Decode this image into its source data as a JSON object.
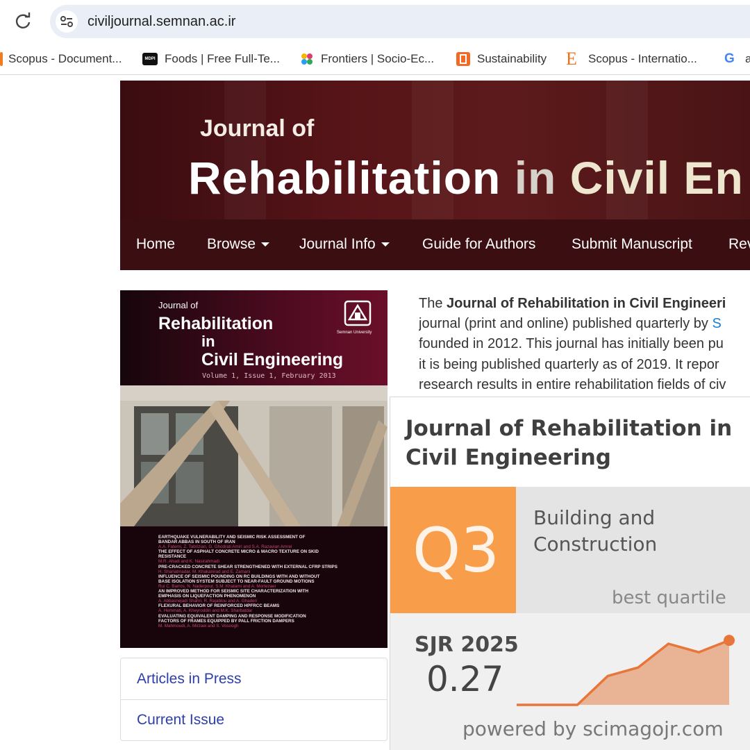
{
  "browser": {
    "url": "civiljournal.semnan.ac.ir",
    "bookmarks": [
      {
        "label": "Scopus - Document...",
        "icon": "scopus-bar-icon",
        "color": "#f07c22"
      },
      {
        "label": "Foods | Free Full-Te...",
        "icon": "mdpi-icon",
        "color": "#111111"
      },
      {
        "label": "Frontiers | Socio-Ec...",
        "icon": "frontiers-icon",
        "color": "#e23b6b"
      },
      {
        "label": "Sustainability",
        "icon": "sustainability-icon",
        "color": "#f26a24"
      },
      {
        "label": "Scopus - Internatio...",
        "icon": "elsevier-icon",
        "color": "#e9711c"
      },
      {
        "label": "a",
        "icon": "google-icon",
        "color": "#4285f4"
      }
    ]
  },
  "banner": {
    "line1": "Journal of",
    "line2_a": "Rehabilitation",
    "line2_b": "in",
    "line2_c": "Civil En"
  },
  "nav": {
    "items": [
      {
        "label": "Home"
      },
      {
        "label": "Browse",
        "dropdown": true
      },
      {
        "label": "Journal Info",
        "dropdown": true
      },
      {
        "label": "Guide for Authors"
      },
      {
        "label": "Submit Manuscript"
      },
      {
        "label": "Rev"
      }
    ]
  },
  "cover": {
    "journal_of": "Journal of",
    "title1": "Rehabilitation",
    "title2": "in",
    "title3": "Civil Engineering",
    "volume": "Volume 1, Issue 1, February 2013",
    "logo_text": "Semnan University",
    "articles": [
      {
        "t": "EARTHQUAKE VULNERABILITY AND SEISMIC RISK ASSESSMENT OF",
        "a": false
      },
      {
        "t": "BANDAR ABBAS IN SOUTH OF IRAN",
        "a": false
      },
      {
        "t": "A.A. Fatemi, Z. Tabrizian, G. Ghodrati Amiri and S.A. Razavian Amrei",
        "a": true
      },
      {
        "t": "THE EFFECT OF ASPHALT CONCRETE MICRO & MACRO TEXTURE ON SKID",
        "a": false
      },
      {
        "t": "RESISTANCE",
        "a": false
      },
      {
        "t": "M.R. Ahadi and K. Nasirahmadi",
        "a": true
      },
      {
        "t": "PRE-CRACKED CONCRETE SHEAR STRENGTHENED WITH EXTERNAL CFRP STRIPS",
        "a": false
      },
      {
        "t": "H. Shariatmadar, M. Khakanirad and E. Zamani",
        "a": true
      },
      {
        "t": "INFLUENCE OF SEISMIC POUNDING ON RC BUILDINGS WITH AND WITHOUT",
        "a": false
      },
      {
        "t": "BASE ISOLATION SYSTEM SUBJECT TO NEAR-FAULT GROUND MOTIONS",
        "a": false
      },
      {
        "t": "Rui C. Barros, N. Naderpour, S.M. Khatami and A. Mortezaei",
        "a": true
      },
      {
        "t": "AN IMPROVED METHOD FOR SEISMIC SITE CHARACTERIZATION WITH",
        "a": false
      },
      {
        "t": "EMPHASIS ON LIQUEFACTION PHENOMENON",
        "a": false
      },
      {
        "t": "A. Abbasnejadi Shahri, R. Rajablou and A. Ghaderi",
        "a": true
      },
      {
        "t": "FLEXURAL BEHAVIOR OF REINFORCED HPFRCC BEAMS",
        "a": false
      },
      {
        "t": "A. Hemmati, A. Kheyroddin and M.K. Sharbatdar",
        "a": true
      },
      {
        "t": "EVALUATING EQUIVALENT DAMPING AND RESPONSE MODIFICATION",
        "a": false
      },
      {
        "t": "FACTORS OF FRAMES EQUIPPED BY PALL FRICTION DAMPERS",
        "a": false
      },
      {
        "t": "M. Mahmoudi, A. Mirzaei and S. Vosoogh",
        "a": true
      }
    ]
  },
  "sidebar_links": [
    {
      "label": "Articles in Press"
    },
    {
      "label": "Current Issue"
    }
  ],
  "intro": {
    "l1_pre": "The ",
    "l1_bold": "Journal of Rehabilitation in Civil Engineeri",
    "l2_pre": "journal (print and online) published quarterly by ",
    "l2_link": "S",
    "l3": "founded in 2012. This journal has initially been pu",
    "l4": "it is being published quarterly as of 2019. It repor",
    "l5": "research results in entire rehabilitation fields of civ"
  },
  "sjr_widget": {
    "title_l1": "Journal of Rehabilitation in",
    "title_l2": "Civil Engineering",
    "quartile": "Q3",
    "category_l1": "Building and",
    "category_l2": "Construction",
    "best_quartile": "best quartile",
    "sjr_label": "SJR 2025",
    "sjr_value": "0.27",
    "powered_by": "powered by scimagojr.com",
    "accent_color": "#f89e4a"
  },
  "chart_data": {
    "type": "area",
    "series": [
      {
        "values": [
          0.0,
          0.0,
          0.0,
          0.17,
          0.22,
          0.36,
          0.31,
          0.38
        ]
      }
    ],
    "ylim": [
      0,
      0.45
    ],
    "highlight_last": true
  }
}
